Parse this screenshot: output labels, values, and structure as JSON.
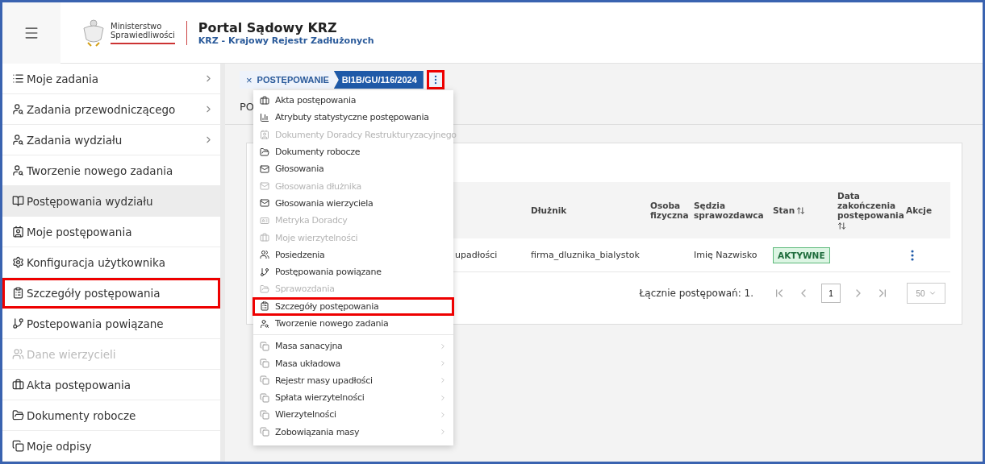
{
  "header": {
    "ministry_line1": "Ministerstwo",
    "ministry_line2": "Sprawiedliwości",
    "title": "Portal Sądowy KRZ",
    "subtitle": "KRZ - Krajowy Rejestr Zadłużonych"
  },
  "sidebar": {
    "items": [
      {
        "label": "Moje zadania",
        "kind": "list",
        "has_submenu": true,
        "selected": false,
        "disabled": false,
        "highlighted": false
      },
      {
        "label": "Zadania przewodniczącego",
        "kind": "user",
        "has_submenu": true,
        "selected": false,
        "disabled": false,
        "highlighted": false
      },
      {
        "label": "Zadania wydziału",
        "kind": "user",
        "has_submenu": true,
        "selected": false,
        "disabled": false,
        "highlighted": false
      },
      {
        "label": "Tworzenie nowego zadania",
        "kind": "user",
        "has_submenu": false,
        "selected": false,
        "disabled": false,
        "highlighted": false
      },
      {
        "label": "Postępowania wydziału",
        "kind": "book",
        "has_submenu": false,
        "selected": true,
        "disabled": false,
        "highlighted": false
      },
      {
        "label": "Moje postępowania",
        "kind": "badge",
        "has_submenu": false,
        "selected": false,
        "disabled": false,
        "highlighted": false
      },
      {
        "label": "Konfiguracja użytkownika",
        "kind": "gear",
        "has_submenu": false,
        "selected": false,
        "disabled": false,
        "highlighted": false
      },
      {
        "label": "Szczegóły postępowania",
        "kind": "clipboard",
        "has_submenu": false,
        "selected": false,
        "disabled": false,
        "highlighted": true
      },
      {
        "label": "Postepowania powiązane",
        "kind": "link",
        "has_submenu": false,
        "selected": false,
        "disabled": false,
        "highlighted": false
      },
      {
        "label": "Dane wierzycieli",
        "kind": "users",
        "has_submenu": false,
        "selected": false,
        "disabled": true,
        "highlighted": false
      },
      {
        "label": "Akta postępowania",
        "kind": "briefcase",
        "has_submenu": false,
        "selected": false,
        "disabled": false,
        "highlighted": false
      },
      {
        "label": "Dokumenty robocze",
        "kind": "folder",
        "has_submenu": false,
        "selected": false,
        "disabled": false,
        "highlighted": false
      },
      {
        "label": "Moje odpisy",
        "kind": "copy",
        "has_submenu": false,
        "selected": false,
        "disabled": false,
        "highlighted": false
      }
    ]
  },
  "breadcrumb": {
    "close": "×",
    "section": "POSTĘPOWANIE",
    "case": "BI1B/GU/116/2024",
    "menu_highlighted": true
  },
  "tab_label": "PO",
  "context_menu": {
    "items": [
      {
        "label": "Akta postępowania",
        "kind": "briefcase",
        "disabled": false,
        "highlighted": false
      },
      {
        "label": "Atrybuty statystyczne postępowania",
        "kind": "chart",
        "disabled": false,
        "highlighted": false
      },
      {
        "label": "Dokumenty Doradcy Restrukturyzacyjnego",
        "kind": "badge",
        "disabled": true,
        "highlighted": false
      },
      {
        "label": "Dokumenty robocze",
        "kind": "folder",
        "disabled": false,
        "highlighted": false
      },
      {
        "label": "Głosowania",
        "kind": "mail",
        "disabled": false,
        "highlighted": false
      },
      {
        "label": "Głosowania dłużnika",
        "kind": "mail",
        "disabled": true,
        "highlighted": false
      },
      {
        "label": "Głosowania wierzyciela",
        "kind": "mail",
        "disabled": false,
        "highlighted": false
      },
      {
        "label": "Metryka Doradcy",
        "kind": "card",
        "disabled": true,
        "highlighted": false
      },
      {
        "label": "Moje wierzytelności",
        "kind": "briefcase",
        "disabled": true,
        "highlighted": false
      },
      {
        "label": "Posiedzenia",
        "kind": "users",
        "disabled": false,
        "highlighted": false
      },
      {
        "label": "Postępowania powiązane",
        "kind": "link",
        "disabled": false,
        "highlighted": false
      },
      {
        "label": "Sprawozdania",
        "kind": "folder",
        "disabled": true,
        "highlighted": false
      },
      {
        "label": "Szczegóły postępowania",
        "kind": "clipboard",
        "disabled": false,
        "highlighted": true
      },
      {
        "label": "Tworzenie nowego zadania",
        "kind": "user",
        "disabled": false,
        "highlighted": false
      }
    ],
    "submenus": [
      {
        "label": "Masa sanacyjna"
      },
      {
        "label": "Masa układowa"
      },
      {
        "label": "Rejestr masy upadłości"
      },
      {
        "label": "Spłata wierzytelności"
      },
      {
        "label": "Wierzytelności"
      },
      {
        "label": "Zobowiązania masy"
      }
    ]
  },
  "table": {
    "columns": [
      {
        "label": "Dłużnik",
        "sortable": false
      },
      {
        "label": "Osoba fizyczna",
        "sortable": false
      },
      {
        "label": "Sędzia sprawozdawca",
        "sortable": false
      },
      {
        "label": "Stan",
        "sortable": true
      },
      {
        "label": "Data zakończenia postępowania",
        "sortable": true
      },
      {
        "label": "Akcje",
        "sortable": false
      }
    ],
    "rows": [
      {
        "column_2": "upadłości",
        "debtor": "firma_dluznika_bialystok",
        "judge": "Imię Nazwisko",
        "status": "AKTYWNE"
      }
    ]
  },
  "pagination": {
    "total": "Łącznie postępowań: 1.",
    "page": "1",
    "page_size": "50"
  }
}
